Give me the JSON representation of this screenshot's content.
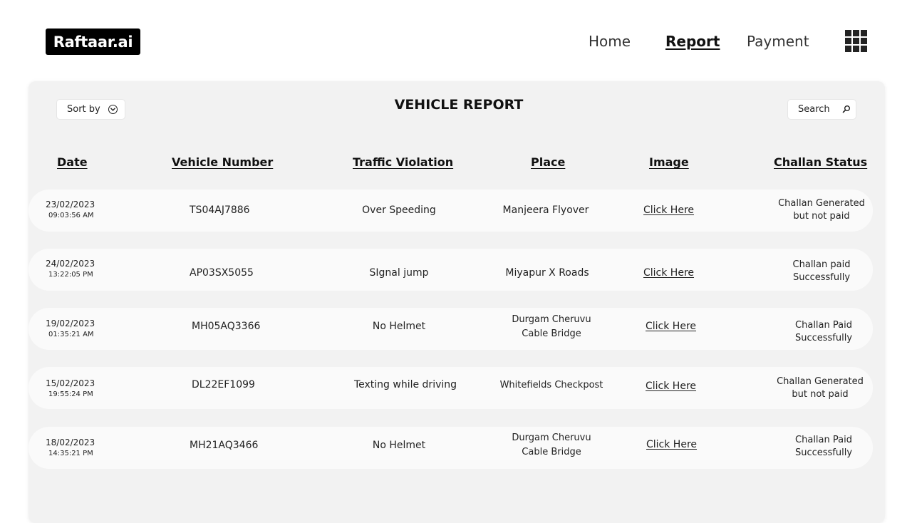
{
  "header": {
    "logo": "Raftaar.ai",
    "nav": {
      "home": "Home",
      "report": "Report",
      "payment": "Payment"
    }
  },
  "toolbar": {
    "sort_label": "Sort by",
    "title": "VEHICLE REPORT",
    "search_label": "Search"
  },
  "table": {
    "columns": [
      "Date",
      "Vehicle Number",
      "Traffic Violation",
      "Place",
      "Image",
      "Challan Status"
    ],
    "rows": [
      {
        "date": "23/02/2023",
        "time": "09:03:56 AM",
        "vehicle": "TS04AJ7886",
        "violation": "Over Speeding",
        "place": "Manjeera Flyover",
        "image": "Click Here",
        "status": "Challan Generated but not paid"
      },
      {
        "date": "24/02/2023",
        "time": "13:22:05 PM",
        "vehicle": "AP03SX5055",
        "violation": "SIgnal jump",
        "place": "Miyapur X Roads",
        "image": "Click Here",
        "status": "Challan paid Successfully"
      },
      {
        "date": "19/02/2023",
        "time": "01:35:21 AM",
        "vehicle": "MH05AQ3366",
        "violation": "No Helmet",
        "place": "Durgam Cheruvu Cable Bridge",
        "image": "Click Here",
        "status": "Challan Paid Successfully"
      },
      {
        "date": "15/02/2023",
        "time": "19:55:24 PM",
        "vehicle": "DL22EF1099",
        "violation": "Texting while driving",
        "place": "Whitefields Checkpost",
        "image": "Click Here",
        "status": "Challan Generated but not paid"
      },
      {
        "date": "18/02/2023",
        "time": "14:35:21 PM",
        "vehicle": "MH21AQ3466",
        "violation": "No Helmet",
        "place": "Durgam Cheruvu Cable Bridge",
        "image": "Click Here",
        "status": "Challan Paid Successfully"
      }
    ]
  }
}
